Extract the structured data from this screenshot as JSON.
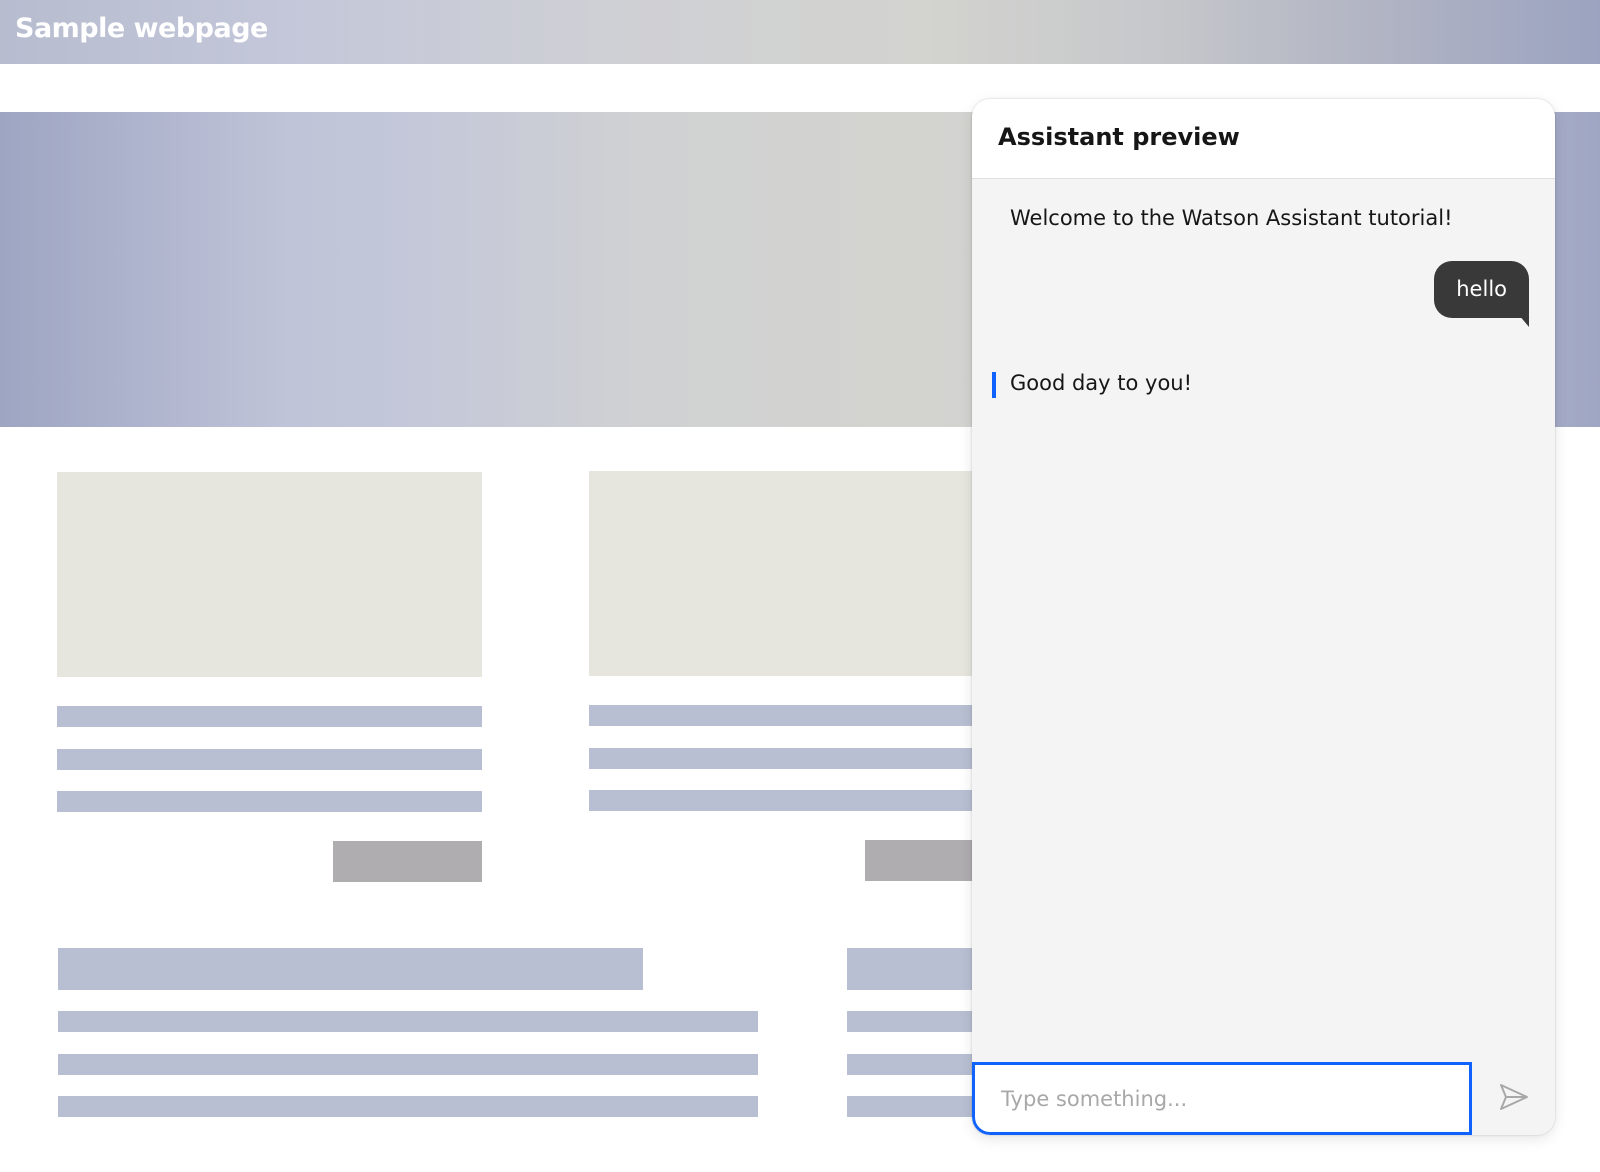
{
  "page": {
    "title": "Sample webpage"
  },
  "chat": {
    "title": "Assistant preview",
    "messages": [
      {
        "from": "assistant",
        "text": "Welcome to the Watson Assistant tutorial!"
      },
      {
        "from": "user",
        "text": "hello"
      },
      {
        "from": "assistant",
        "text": "Good day to you!"
      }
    ],
    "input": {
      "placeholder": "Type something...",
      "value": ""
    },
    "send_icon": "send-icon"
  },
  "colors": {
    "accent": "#0f62fe",
    "user_bubble": "#393939",
    "chat_background": "#f4f4f4"
  }
}
